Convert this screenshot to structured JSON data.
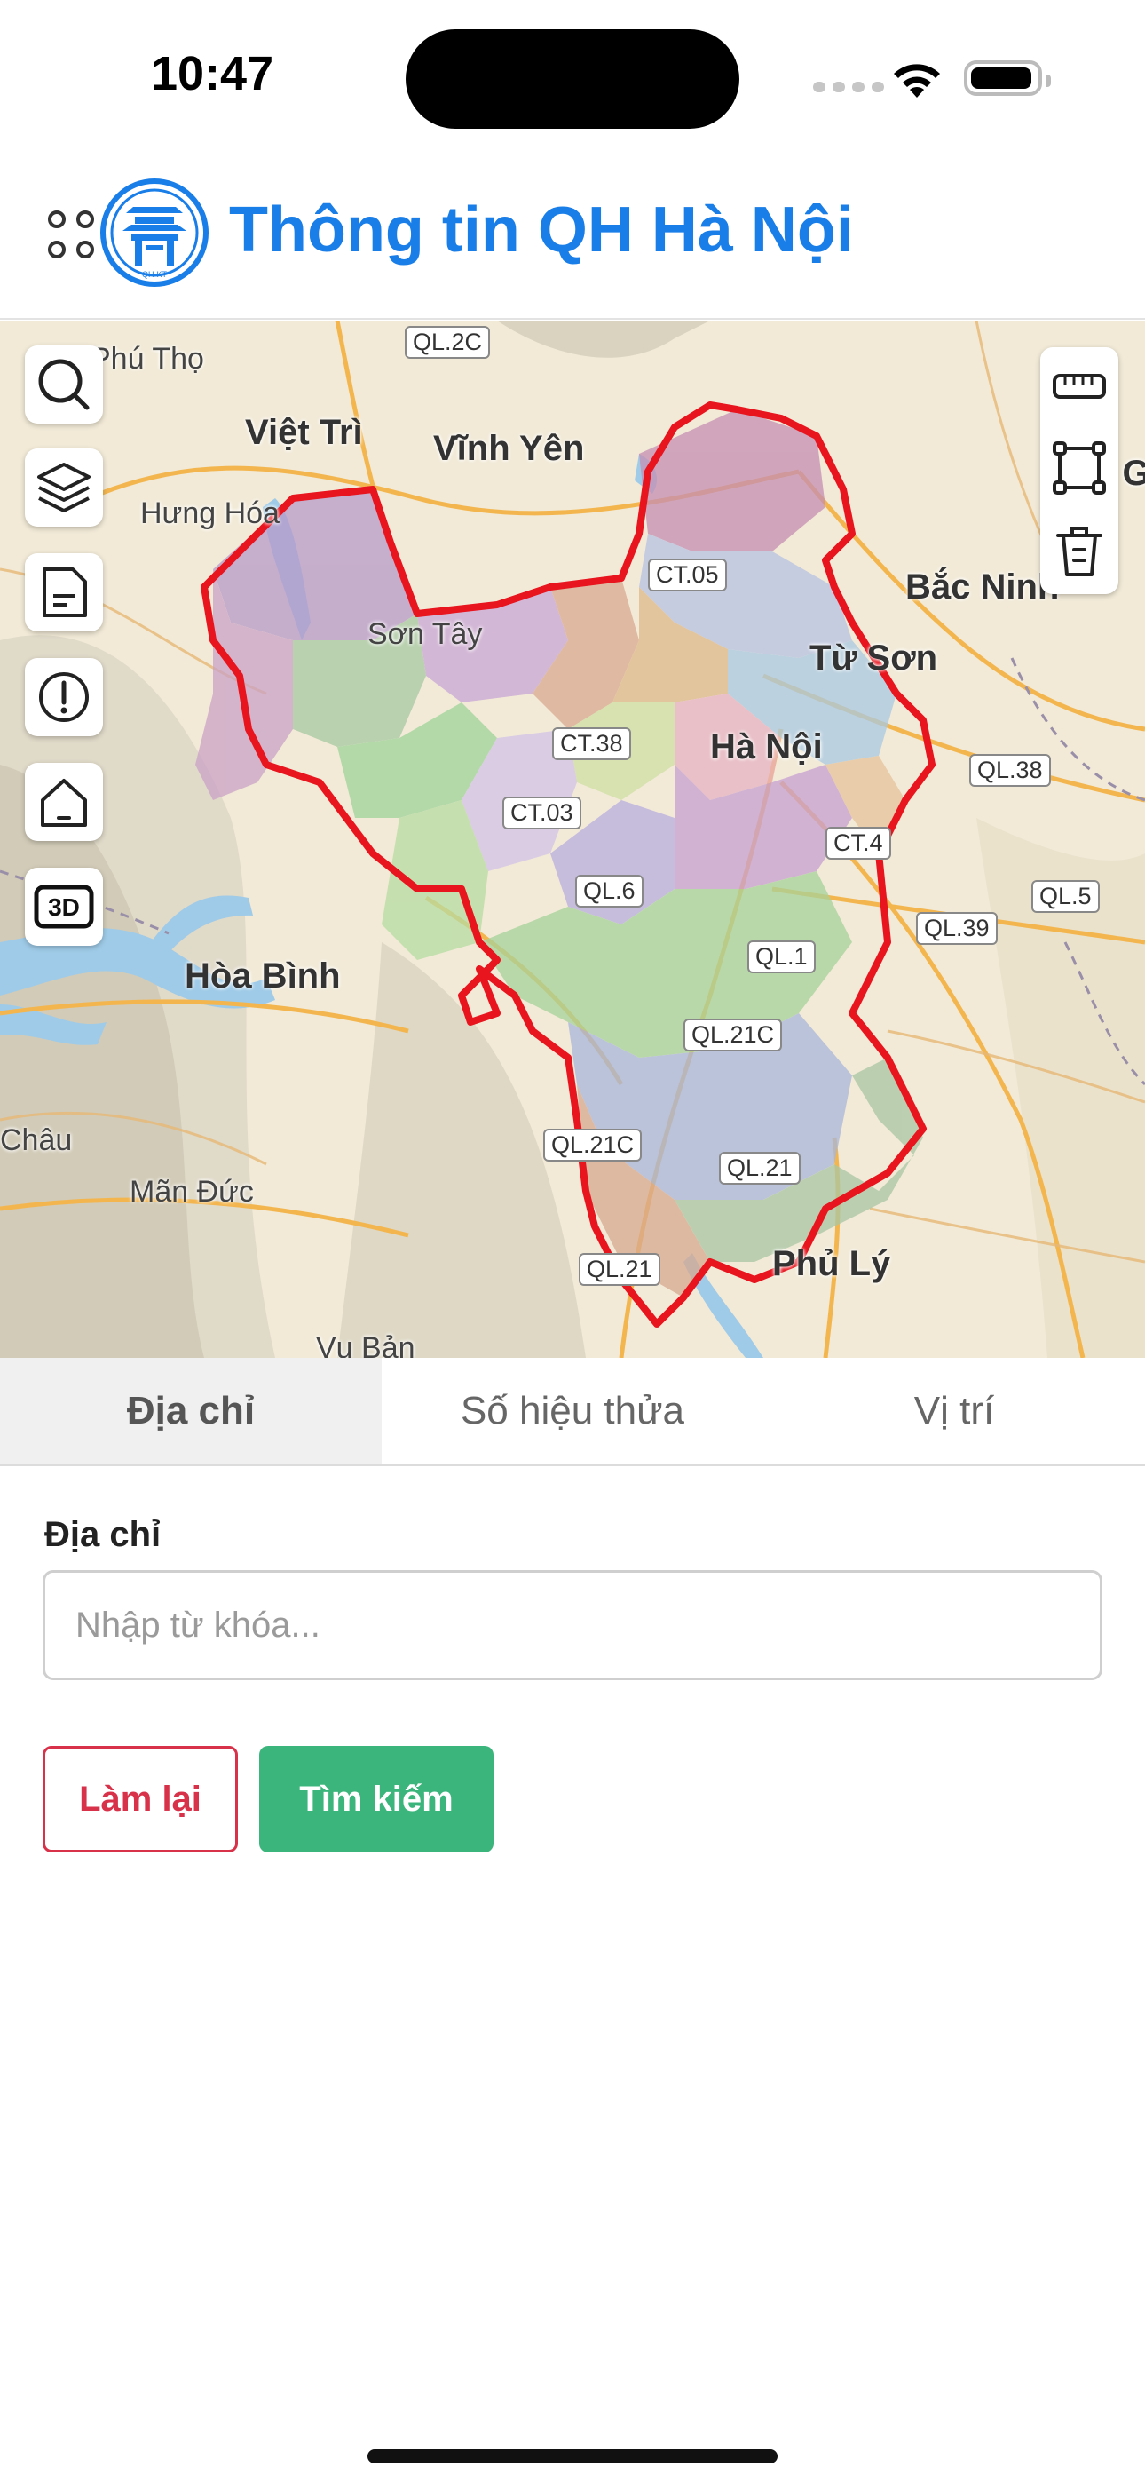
{
  "status_bar": {
    "time": "10:47"
  },
  "header": {
    "title": "Thông tin QH Hà Nội",
    "logo_text": "QH-KT"
  },
  "map": {
    "places": [
      {
        "id": "phu-tho",
        "name": "Phú Thọ"
      },
      {
        "id": "viet-tri",
        "name": "Việt Trì"
      },
      {
        "id": "vinh-yen",
        "name": "Vĩnh Yên"
      },
      {
        "id": "hung-hoa",
        "name": "Hưng Hóa"
      },
      {
        "id": "son-tay",
        "name": "Sơn Tây"
      },
      {
        "id": "bac-ninh",
        "name": "Bắc Ninh"
      },
      {
        "id": "tu-son",
        "name": "Từ Sơn"
      },
      {
        "id": "ha-noi",
        "name": "Hà Nội"
      },
      {
        "id": "hoa-binh",
        "name": "Hòa Bình"
      },
      {
        "id": "chau",
        "name": "Châu"
      },
      {
        "id": "man-duc",
        "name": "Mãn Đức"
      },
      {
        "id": "phu-ly",
        "name": "Phủ Lý"
      },
      {
        "id": "vu-ban",
        "name": "Vụ Bản"
      },
      {
        "id": "bac-giang",
        "name": "Bắc Gi"
      }
    ],
    "roads": [
      "QL.2C",
      "CT.05",
      "CT.38",
      "CT.03",
      "QL.6",
      "QL.38",
      "QL.5",
      "QL.39",
      "QL.1",
      "QL.21C",
      "QL.21",
      "QL.21C",
      "QL.21",
      "CT.4"
    ],
    "left_tools": [
      "search-icon",
      "layers-icon",
      "document-icon",
      "alert-icon",
      "home-icon",
      "3d-icon"
    ],
    "right_tools": [
      "ruler-icon",
      "polygon-icon",
      "trash-icon"
    ],
    "three_d_label": "3D"
  },
  "tabs": [
    {
      "label": "Địa chỉ",
      "active": true
    },
    {
      "label": "Số hiệu thửa",
      "active": false
    },
    {
      "label": "Vị trí",
      "active": false
    }
  ],
  "form": {
    "address_label": "Địa chỉ",
    "address_placeholder": "Nhập từ khóa...",
    "address_value": "",
    "reset_label": "Làm lại",
    "search_label": "Tìm kiếm"
  },
  "colors": {
    "accent": "#1a7ee8",
    "search_button": "#3cb57c",
    "reset_button": "#d8324a",
    "boundary": "#e8141e"
  }
}
